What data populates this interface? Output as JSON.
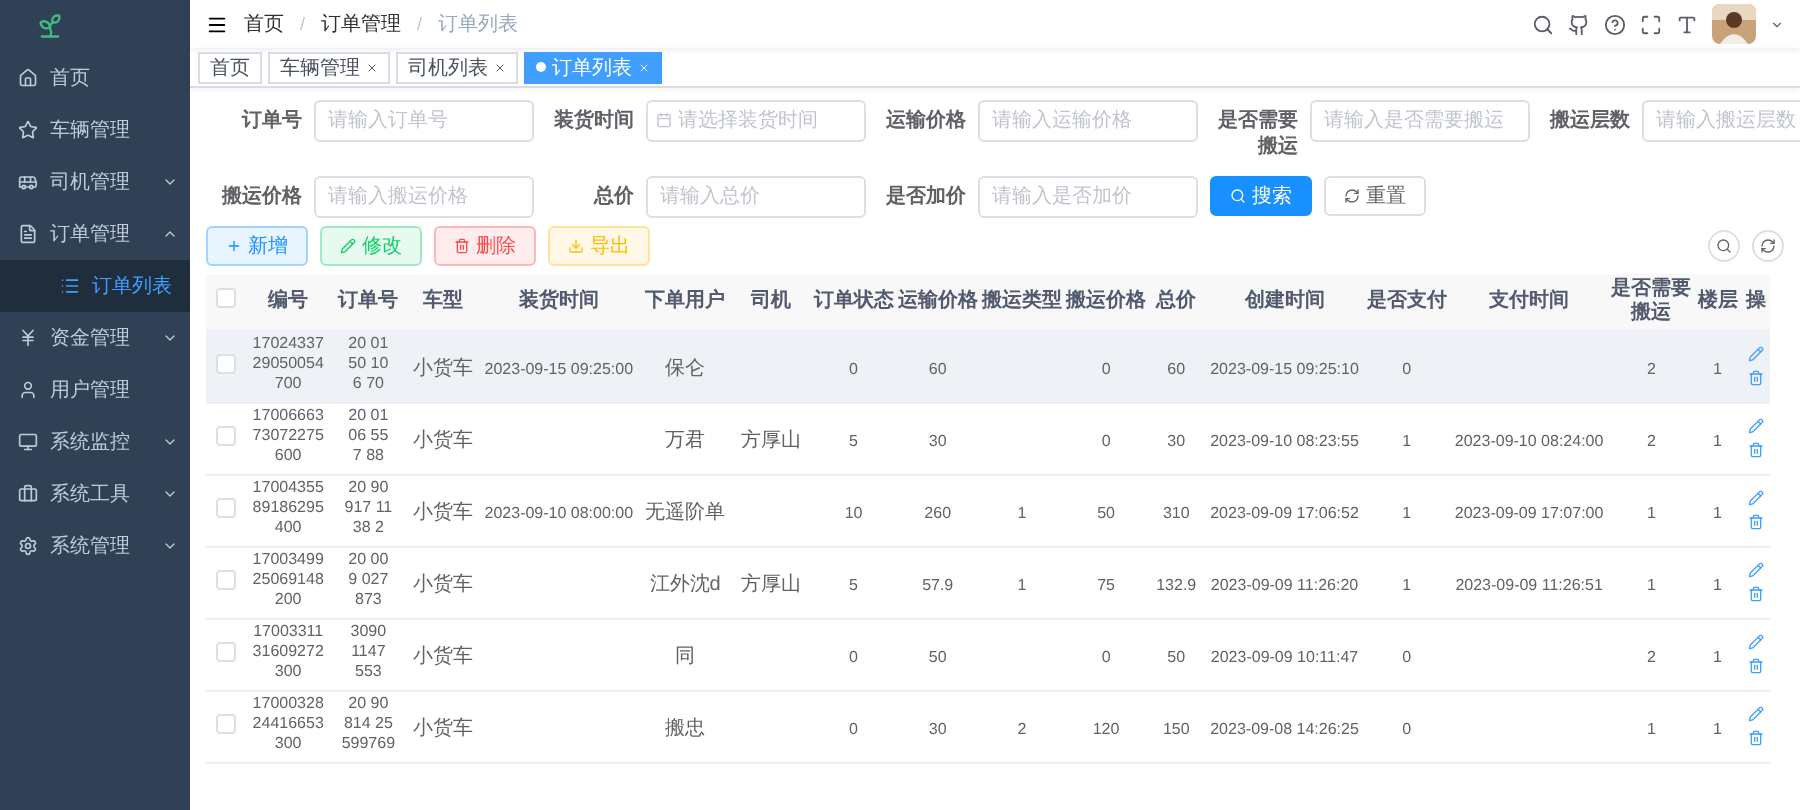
{
  "sidebar": {
    "items": [
      {
        "label": "首页",
        "kind": "link",
        "selected": false
      },
      {
        "label": "车辆管理",
        "kind": "link",
        "selected": false
      },
      {
        "label": "司机管理",
        "kind": "group",
        "expanded": false,
        "selected": false
      },
      {
        "label": "订单管理",
        "kind": "group",
        "expanded": true,
        "selected": false,
        "children": [
          {
            "label": "订单列表",
            "selected": true
          }
        ]
      },
      {
        "label": "资金管理",
        "kind": "group",
        "expanded": false,
        "selected": false
      },
      {
        "label": "用户管理",
        "kind": "link",
        "selected": false
      },
      {
        "label": "系统监控",
        "kind": "group",
        "expanded": false,
        "selected": false
      },
      {
        "label": "系统工具",
        "kind": "group",
        "expanded": false,
        "selected": false
      },
      {
        "label": "系统管理",
        "kind": "group",
        "expanded": false,
        "selected": false
      }
    ]
  },
  "breadcrumb": {
    "separator": "/",
    "items": [
      "首页",
      "订单管理",
      "订单列表"
    ]
  },
  "tabs": [
    {
      "label": "首页",
      "selected": false,
      "closable": false
    },
    {
      "label": "车辆管理",
      "selected": false,
      "closable": true
    },
    {
      "label": "司机列表",
      "selected": false,
      "closable": true
    },
    {
      "label": "订单列表",
      "selected": true,
      "closable": true
    }
  ],
  "filters": [
    {
      "label": "订单号",
      "placeholder": "请输入订单号",
      "kind": "text"
    },
    {
      "label": "装货时间",
      "placeholder": "请选择装货时间",
      "kind": "date"
    },
    {
      "label": "运输价格",
      "placeholder": "请输入运输价格",
      "kind": "text"
    },
    {
      "label": "是否需要搬运",
      "placeholder": "请输入是否需要搬运",
      "kind": "text"
    },
    {
      "label": "搬运层数",
      "placeholder": "请输入搬运层数",
      "kind": "text"
    },
    {
      "label": "搬运价格",
      "placeholder": "请输入搬运价格",
      "kind": "text"
    },
    {
      "label": "总价",
      "placeholder": "请输入总价",
      "kind": "text"
    },
    {
      "label": "是否加价",
      "placeholder": "请输入是否加价",
      "kind": "text"
    }
  ],
  "search_button": "搜索",
  "reset_button": "重置",
  "actions": [
    {
      "label": "新增",
      "kind": "add"
    },
    {
      "label": "修改",
      "kind": "edit"
    },
    {
      "label": "删除",
      "kind": "delete"
    },
    {
      "label": "导出",
      "kind": "export"
    }
  ],
  "table": {
    "all_checked": false,
    "columns": [
      "编号",
      "订单号",
      "车型",
      "装货时间",
      "下单用户",
      "司机",
      "订单状态",
      "运输价格",
      "搬运类型",
      "搬运价格",
      "总价",
      "创建时间",
      "是否支付",
      "支付时间",
      "是否需要搬运",
      "楼层",
      "操"
    ],
    "rows": [
      {
        "highlighted": true,
        "checked": false,
        "cells": [
          "1702433729050054700",
          "20  01\n50  10\n6  70",
          "小货车",
          "2023-09-15 09:25:00",
          "保仑",
          "",
          "0",
          "60",
          "",
          "0",
          "60",
          "2023-09-15 09:25:10",
          "0",
          "",
          "2",
          "1"
        ]
      },
      {
        "highlighted": false,
        "checked": false,
        "cells": [
          "1700666373072275600",
          "20  01\n06  55\n7  88",
          "小货车",
          "",
          "万君",
          "方厚山",
          "5",
          "30",
          "",
          "0",
          "30",
          "2023-09-10 08:23:55",
          "1",
          "2023-09-10 08:24:00",
          "2",
          "1"
        ]
      },
      {
        "highlighted": false,
        "checked": false,
        "cells": [
          "1700435589186295400",
          "20  90\n917  11\n38  2",
          "小货车",
          "2023-09-10 08:00:00",
          "无遥阶单",
          "",
          "10",
          "260",
          "1",
          "50",
          "310",
          "2023-09-09 17:06:52",
          "1",
          "2023-09-09 17:07:00",
          "1",
          "1"
        ]
      },
      {
        "highlighted": false,
        "checked": false,
        "cells": [
          "1700349925069148200",
          "20  00\n9  027\n873",
          "小货车",
          "",
          "江外沈d",
          "方厚山",
          "5",
          "57.9",
          "1",
          "75",
          "132.9",
          "2023-09-09 11:26:20",
          "1",
          "2023-09-09 11:26:51",
          "1",
          "1"
        ]
      },
      {
        "highlighted": false,
        "checked": false,
        "cells": [
          "1700331131609272300",
          "3090\n1147\n553",
          "小货车",
          "",
          "同",
          "",
          "0",
          "50",
          "",
          "0",
          "50",
          "2023-09-09 10:11:47",
          "0",
          "",
          "2",
          "1"
        ]
      },
      {
        "highlighted": false,
        "checked": false,
        "cells": [
          "1700032824416653300",
          "20  90\n814  25\n599769",
          "小货车",
          "",
          "搬忠",
          "",
          "0",
          "30",
          "2",
          "120",
          "150",
          "2023-09-08 14:26:25",
          "0",
          "",
          "1",
          "1"
        ]
      }
    ]
  }
}
